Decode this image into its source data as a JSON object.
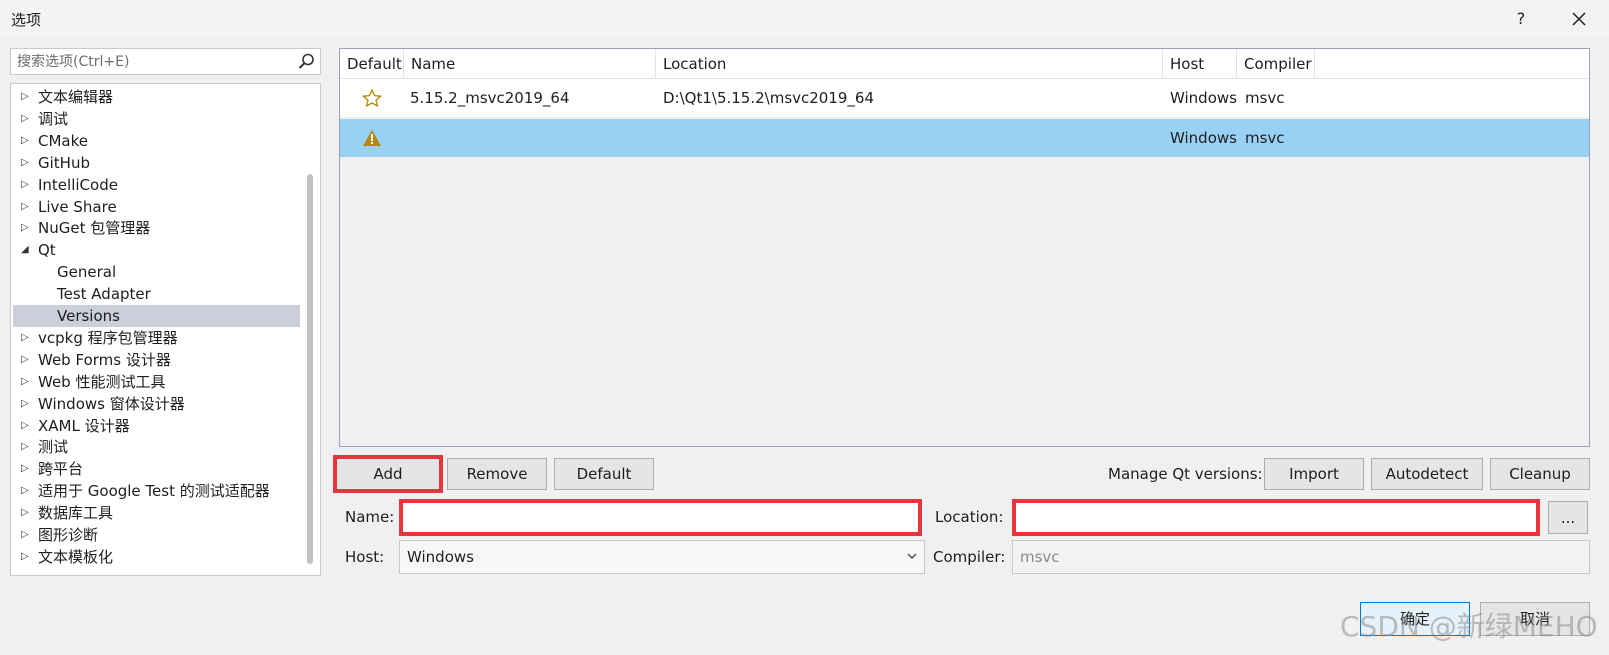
{
  "window": {
    "title": "选项",
    "help": "?"
  },
  "search": {
    "placeholder": "搜索选项(Ctrl+E)"
  },
  "tree": {
    "items": [
      {
        "label": "文本编辑器",
        "arrow": "▷"
      },
      {
        "label": "调试",
        "arrow": "▷"
      },
      {
        "label": "CMake",
        "arrow": "▷"
      },
      {
        "label": "GitHub",
        "arrow": "▷"
      },
      {
        "label": "IntelliCode",
        "arrow": "▷"
      },
      {
        "label": "Live Share",
        "arrow": "▷"
      },
      {
        "label": "NuGet 包管理器",
        "arrow": "▷"
      },
      {
        "label": "Qt",
        "arrow": "◢"
      },
      {
        "label": "General",
        "arrow": ""
      },
      {
        "label": "Test Adapter",
        "arrow": ""
      },
      {
        "label": "Versions",
        "arrow": ""
      },
      {
        "label": "vcpkg 程序包管理器",
        "arrow": "▷"
      },
      {
        "label": "Web Forms 设计器",
        "arrow": "▷"
      },
      {
        "label": "Web 性能测试工具",
        "arrow": "▷"
      },
      {
        "label": "Windows 窗体设计器",
        "arrow": "▷"
      },
      {
        "label": "XAML 设计器",
        "arrow": "▷"
      },
      {
        "label": "测试",
        "arrow": "▷"
      },
      {
        "label": "跨平台",
        "arrow": "▷"
      },
      {
        "label": "适用于 Google Test 的测试适配器",
        "arrow": "▷"
      },
      {
        "label": "数据库工具",
        "arrow": "▷"
      },
      {
        "label": "图形诊断",
        "arrow": "▷"
      },
      {
        "label": "文本模板化",
        "arrow": "▷"
      }
    ]
  },
  "grid": {
    "columns": [
      "Default",
      "Name",
      "Location",
      "Host",
      "Compiler"
    ],
    "rows": [
      {
        "default_icon": "star-icon",
        "name": "5.15.2_msvc2019_64",
        "location": "D:\\Qt1\\5.15.2\\msvc2019_64",
        "host": "Windows",
        "compiler": "msvc"
      },
      {
        "default_icon": "warning-icon",
        "name": "",
        "location": "",
        "host": "Windows",
        "compiler": "msvc"
      }
    ]
  },
  "buttons": {
    "add": "Add",
    "remove": "Remove",
    "default": "Default",
    "manage_label": "Manage Qt versions:",
    "import": "Import",
    "autodetect": "Autodetect",
    "cleanup": "Cleanup",
    "browse": "...",
    "ok": "确定",
    "cancel": "取消"
  },
  "form": {
    "name_label": "Name:",
    "name_value": "",
    "location_label": "Location:",
    "location_value": "",
    "host_label": "Host:",
    "host_value": "Windows",
    "compiler_label": "Compiler:",
    "compiler_value": "msvc"
  },
  "watermark": "CSDN @新绿MEHO",
  "colors": {
    "selection": "#99d1f5",
    "highlight": "#e8343c",
    "tree_selected": "#cccedb"
  }
}
